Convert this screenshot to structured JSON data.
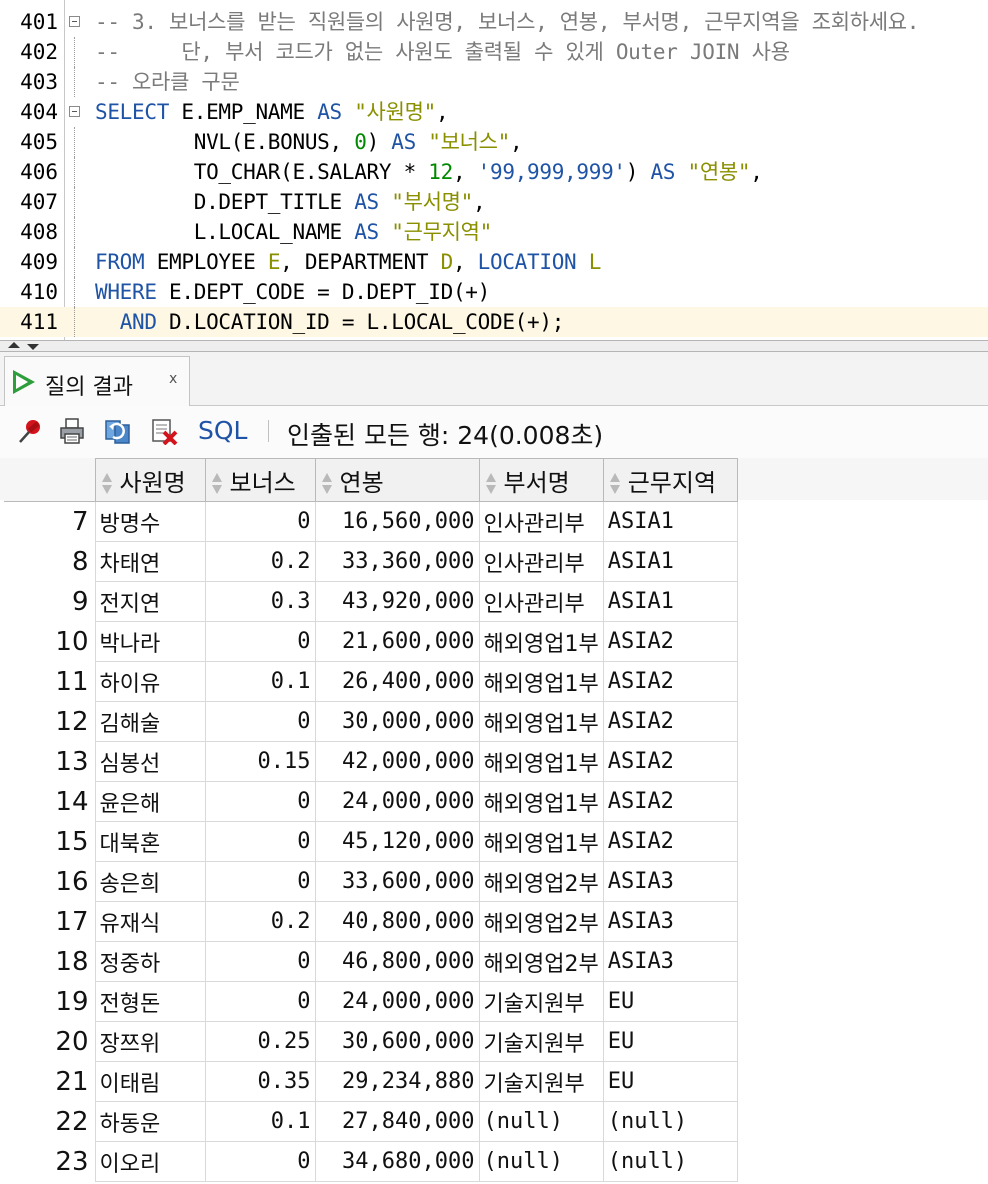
{
  "editor": {
    "lines": [
      {
        "num": "401",
        "fold": true,
        "tokens": [
          {
            "t": "cmt",
            "v": "-- 3. 보너스를 받는 직원들의 사원명, 보너스, 연봉, 부서명, 근무지역을 조회하세요."
          }
        ]
      },
      {
        "num": "402",
        "fold": false,
        "tokens": [
          {
            "t": "cmt",
            "v": "--     단, 부서 코드가 없는 사원도 출력될 수 있게 Outer JOIN 사용"
          }
        ]
      },
      {
        "num": "403",
        "fold": false,
        "tokens": [
          {
            "t": "cmt",
            "v": "-- 오라클 구문"
          }
        ]
      },
      {
        "num": "404",
        "fold": true,
        "tokens": [
          {
            "t": "kw",
            "v": "SELECT"
          },
          {
            "t": "",
            "v": " E.EMP_NAME "
          },
          {
            "t": "kw",
            "v": "AS"
          },
          {
            "t": "",
            "v": " "
          },
          {
            "t": "str",
            "v": "\"사원명\""
          },
          {
            "t": "",
            "v": ","
          }
        ]
      },
      {
        "num": "405",
        "fold": false,
        "tokens": [
          {
            "t": "",
            "v": "        NVL(E.BONUS, "
          },
          {
            "t": "num",
            "v": "0"
          },
          {
            "t": "",
            "v": ") "
          },
          {
            "t": "kw",
            "v": "AS"
          },
          {
            "t": "",
            "v": " "
          },
          {
            "t": "str",
            "v": "\"보너스\""
          },
          {
            "t": "",
            "v": ","
          }
        ]
      },
      {
        "num": "406",
        "fold": false,
        "tokens": [
          {
            "t": "",
            "v": "        TO_CHAR(E.SALARY * "
          },
          {
            "t": "num",
            "v": "12"
          },
          {
            "t": "",
            "v": ", "
          },
          {
            "t": "q",
            "v": "'99,999,999'"
          },
          {
            "t": "",
            "v": ") "
          },
          {
            "t": "kw",
            "v": "AS"
          },
          {
            "t": "",
            "v": " "
          },
          {
            "t": "str",
            "v": "\"연봉\""
          },
          {
            "t": "",
            "v": ","
          }
        ]
      },
      {
        "num": "407",
        "fold": false,
        "tokens": [
          {
            "t": "",
            "v": "        D.DEPT_TITLE "
          },
          {
            "t": "kw",
            "v": "AS"
          },
          {
            "t": "",
            "v": " "
          },
          {
            "t": "str",
            "v": "\"부서명\""
          },
          {
            "t": "",
            "v": ","
          }
        ]
      },
      {
        "num": "408",
        "fold": false,
        "tokens": [
          {
            "t": "",
            "v": "        L.LOCAL_NAME "
          },
          {
            "t": "kw",
            "v": "AS"
          },
          {
            "t": "",
            "v": " "
          },
          {
            "t": "str",
            "v": "\"근무지역\""
          }
        ]
      },
      {
        "num": "409",
        "fold": false,
        "tokens": [
          {
            "t": "kw",
            "v": "FROM"
          },
          {
            "t": "",
            "v": " EMPLOYEE "
          },
          {
            "t": "str",
            "v": "E"
          },
          {
            "t": "",
            "v": ", DEPARTMENT "
          },
          {
            "t": "str",
            "v": "D"
          },
          {
            "t": "",
            "v": ", "
          },
          {
            "t": "kw",
            "v": "LOCATION"
          },
          {
            "t": "",
            "v": " "
          },
          {
            "t": "str",
            "v": "L"
          }
        ]
      },
      {
        "num": "410",
        "fold": false,
        "tokens": [
          {
            "t": "kw",
            "v": "WHERE"
          },
          {
            "t": "",
            "v": " E.DEPT_CODE = D.DEPT_ID(+)"
          }
        ]
      },
      {
        "num": "411",
        "fold": false,
        "current": true,
        "tokens": [
          {
            "t": "",
            "v": "  "
          },
          {
            "t": "kw",
            "v": "AND"
          },
          {
            "t": "",
            "v": " D.LOCATION_ID = L.LOCAL_CODE(+);"
          }
        ]
      }
    ]
  },
  "result_tab": {
    "label": "질의 결과",
    "close": "x"
  },
  "toolbar": {
    "sql_label": "SQL",
    "status": "인출된 모든 행: 24(0.008초)",
    "icons": [
      "pin-icon",
      "print-icon",
      "refresh-icon",
      "export-icon"
    ]
  },
  "grid": {
    "columns": [
      "사원명",
      "보너스",
      "연봉",
      "부서명",
      "근무지역"
    ],
    "rows": [
      {
        "rn": "7",
        "cells": [
          "방명수",
          "0",
          "16,560,000",
          "인사관리부",
          "ASIA1"
        ]
      },
      {
        "rn": "8",
        "cells": [
          "차태연",
          "0.2",
          "33,360,000",
          "인사관리부",
          "ASIA1"
        ]
      },
      {
        "rn": "9",
        "cells": [
          "전지연",
          "0.3",
          "43,920,000",
          "인사관리부",
          "ASIA1"
        ]
      },
      {
        "rn": "10",
        "cells": [
          "박나라",
          "0",
          "21,600,000",
          "해외영업1부",
          "ASIA2"
        ]
      },
      {
        "rn": "11",
        "cells": [
          "하이유",
          "0.1",
          "26,400,000",
          "해외영업1부",
          "ASIA2"
        ]
      },
      {
        "rn": "12",
        "cells": [
          "김해술",
          "0",
          "30,000,000",
          "해외영업1부",
          "ASIA2"
        ]
      },
      {
        "rn": "13",
        "cells": [
          "심봉선",
          "0.15",
          "42,000,000",
          "해외영업1부",
          "ASIA2"
        ]
      },
      {
        "rn": "14",
        "cells": [
          "윤은해",
          "0",
          "24,000,000",
          "해외영업1부",
          "ASIA2"
        ]
      },
      {
        "rn": "15",
        "cells": [
          "대북혼",
          "0",
          "45,120,000",
          "해외영업1부",
          "ASIA2"
        ]
      },
      {
        "rn": "16",
        "cells": [
          "송은희",
          "0",
          "33,600,000",
          "해외영업2부",
          "ASIA3"
        ]
      },
      {
        "rn": "17",
        "cells": [
          "유재식",
          "0.2",
          "40,800,000",
          "해외영업2부",
          "ASIA3"
        ]
      },
      {
        "rn": "18",
        "cells": [
          "정중하",
          "0",
          "46,800,000",
          "해외영업2부",
          "ASIA3"
        ]
      },
      {
        "rn": "19",
        "cells": [
          "전형돈",
          "0",
          "24,000,000",
          "기술지원부",
          "EU"
        ]
      },
      {
        "rn": "20",
        "cells": [
          "장쯔위",
          "0.25",
          "30,600,000",
          "기술지원부",
          "EU"
        ]
      },
      {
        "rn": "21",
        "cells": [
          "이태림",
          "0.35",
          "29,234,880",
          "기술지원부",
          "EU"
        ]
      },
      {
        "rn": "22",
        "cells": [
          "하동운",
          "0.1",
          "27,840,000",
          "(null)",
          "(null)"
        ]
      },
      {
        "rn": "23",
        "cells": [
          "이오리",
          "0",
          "34,680,000",
          "(null)",
          "(null)"
        ]
      }
    ]
  },
  "colors": {
    "keyword": "#1f53a5",
    "string": "#8a8f00",
    "number": "#008800",
    "comment": "#7a7a7a",
    "current_line": "#fdf7e3",
    "run_icon": "#2e9e3c"
  }
}
